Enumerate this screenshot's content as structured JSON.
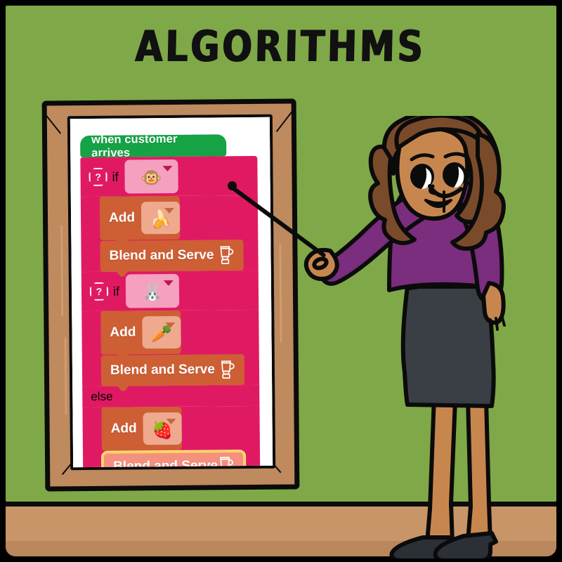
{
  "scene": {
    "title": "ALGORITHMS",
    "colors": {
      "wall": "#7FA848",
      "floor": "#C89568",
      "frame": "#BE8A5E",
      "paper": "#FFFFFF",
      "event_block": "#15A345",
      "control_block": "#E01A62",
      "action_block": "#CE5E34",
      "highlight_block": "#F4907E",
      "highlight_outline": "#FFD15C",
      "skin": "#C8864F",
      "hair": "#7A4B2A",
      "top": "#7B2D7E",
      "skirt": "#393F45",
      "shoes": "#2B3036",
      "outline": "#0B0B0B"
    }
  },
  "board": {
    "name": "whiteboard-with-block-code",
    "script": {
      "hat": {
        "label": "when customer arrives",
        "icon": "event-hat-icon"
      },
      "branches": [
        {
          "keyword": "if",
          "condition_icon": "monkey-face-emoji",
          "condition_emoji": "🐵",
          "help_icon": "question-mark-octagon-icon",
          "body": [
            {
              "label": "Add",
              "ingredient_emoji": "🍌",
              "ingredient_icon": "banana-emoji",
              "type": "add"
            },
            {
              "label": "Blend and Serve",
              "icon": "blender-icon",
              "type": "blend",
              "highlighted": false
            }
          ]
        },
        {
          "keyword": "if",
          "condition_icon": "rabbit-face-emoji",
          "condition_emoji": "🐰",
          "help_icon": "question-mark-octagon-icon",
          "body": [
            {
              "label": "Add",
              "ingredient_emoji": "🥕",
              "ingredient_icon": "carrot-emoji",
              "type": "add"
            },
            {
              "label": "Blend and Serve",
              "icon": "blender-icon",
              "type": "blend",
              "highlighted": false
            }
          ]
        },
        {
          "keyword": "else",
          "condition_icon": null,
          "condition_emoji": null,
          "help_icon": null,
          "body": [
            {
              "label": "Add",
              "ingredient_emoji": "🍓",
              "ingredient_icon": "strawberry-emoji",
              "type": "add"
            },
            {
              "label": "Blend and Serve",
              "icon": "blender-icon",
              "type": "blend",
              "highlighted": true
            }
          ]
        }
      ]
    }
  },
  "teacher": {
    "name": "teacher-character",
    "pointer": "pointer-stick",
    "pointing_at": "Blend and Serve"
  }
}
